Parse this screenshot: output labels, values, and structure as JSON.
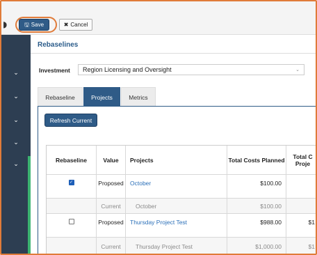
{
  "toolbar": {
    "save_label": "Save",
    "save_icon": "floppy-disk-icon",
    "cancel_label": "Cancel",
    "cancel_icon": "x-icon",
    "left_glyph": "◗"
  },
  "sidebar": {
    "items": [
      {
        "icon": "chevron-down-icon",
        "glyph": "⌄"
      },
      {
        "icon": "chevron-down-icon",
        "glyph": "⌄"
      },
      {
        "icon": "chevron-down-icon",
        "glyph": "⌄"
      },
      {
        "icon": "chevron-down-icon",
        "glyph": "⌄"
      },
      {
        "icon": "chevron-down-icon",
        "glyph": "⌄"
      }
    ],
    "bg": "#2d3e52",
    "accent": "#3cb371"
  },
  "page": {
    "title": "Rebaselines"
  },
  "investment": {
    "label": "Investment",
    "value": "Region Licensing and Oversight",
    "caret": "⌄"
  },
  "tabs": [
    {
      "label": "Rebaseline",
      "active": false
    },
    {
      "label": "Projects",
      "active": true
    },
    {
      "label": "Metrics",
      "active": false
    }
  ],
  "refresh_label": "Refresh Current",
  "table": {
    "headers": [
      "Rebaseline",
      "Value",
      "Projects",
      "Total Costs Planned",
      "Total C Proje"
    ],
    "rows": [
      {
        "checked": true,
        "value": "Proposed",
        "project": "October",
        "planned": "$100.00",
        "extra": ""
      },
      {
        "checked": null,
        "value": "Current",
        "project": "October",
        "planned": "$100.00",
        "extra": ""
      },
      {
        "checked": false,
        "value": "Proposed",
        "project": "Thursday Project Test",
        "planned": "$988.00",
        "extra": "$1"
      },
      {
        "checked": null,
        "value": "Current",
        "project": "Thursday Project Test",
        "planned": "$1,000.00",
        "extra": "$1"
      }
    ]
  },
  "colors": {
    "primary": "#2f5b87",
    "link": "#2a6fb8",
    "highlight": "#e07b39"
  }
}
